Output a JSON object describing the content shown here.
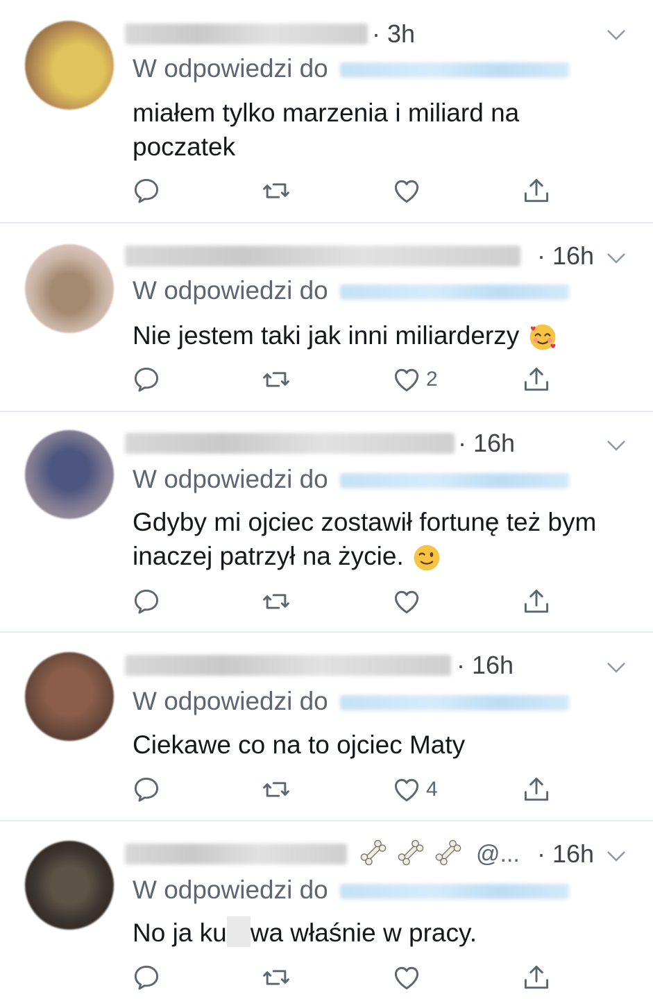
{
  "tweets": [
    {
      "time": "· 3h",
      "reply_label": "W odpowiedzi do",
      "text": "miałem tylko marzenia i miliard na poczatek",
      "likes": ""
    },
    {
      "time": "· 16h",
      "reply_label": "W odpowiedzi do",
      "text": "Nie jestem taki jak inni miliarderzy",
      "likes": "2"
    },
    {
      "time": "· 16h",
      "reply_label": "W odpowiedzi do",
      "text_line1": "Gdyby mi ojciec zostawił fortunę też bym",
      "text_line2": "inaczej patrzył na życie.",
      "likes": ""
    },
    {
      "time": "· 16h",
      "reply_label": "W odpowiedzi do",
      "text": "Ciekawe co na to ojciec Maty",
      "likes": "4"
    },
    {
      "time": "· 16h",
      "reply_label": "W odpowiedzi do",
      "handle_partial": "@...",
      "text_a": "No ja ku",
      "text_b": "wa właśnie w pracy.",
      "likes": ""
    }
  ],
  "icons": [
    "reply-icon",
    "retweet-icon",
    "like-icon",
    "share-icon",
    "chevron-down-icon",
    "smiling-face-with-hearts-emoji",
    "winking-face-emoji",
    "bone-emoji"
  ],
  "colors": {
    "icon": "#5b6670",
    "text": "#14171a",
    "divider": "#e6ecf0",
    "handle_blur": "#c5e1f5"
  }
}
